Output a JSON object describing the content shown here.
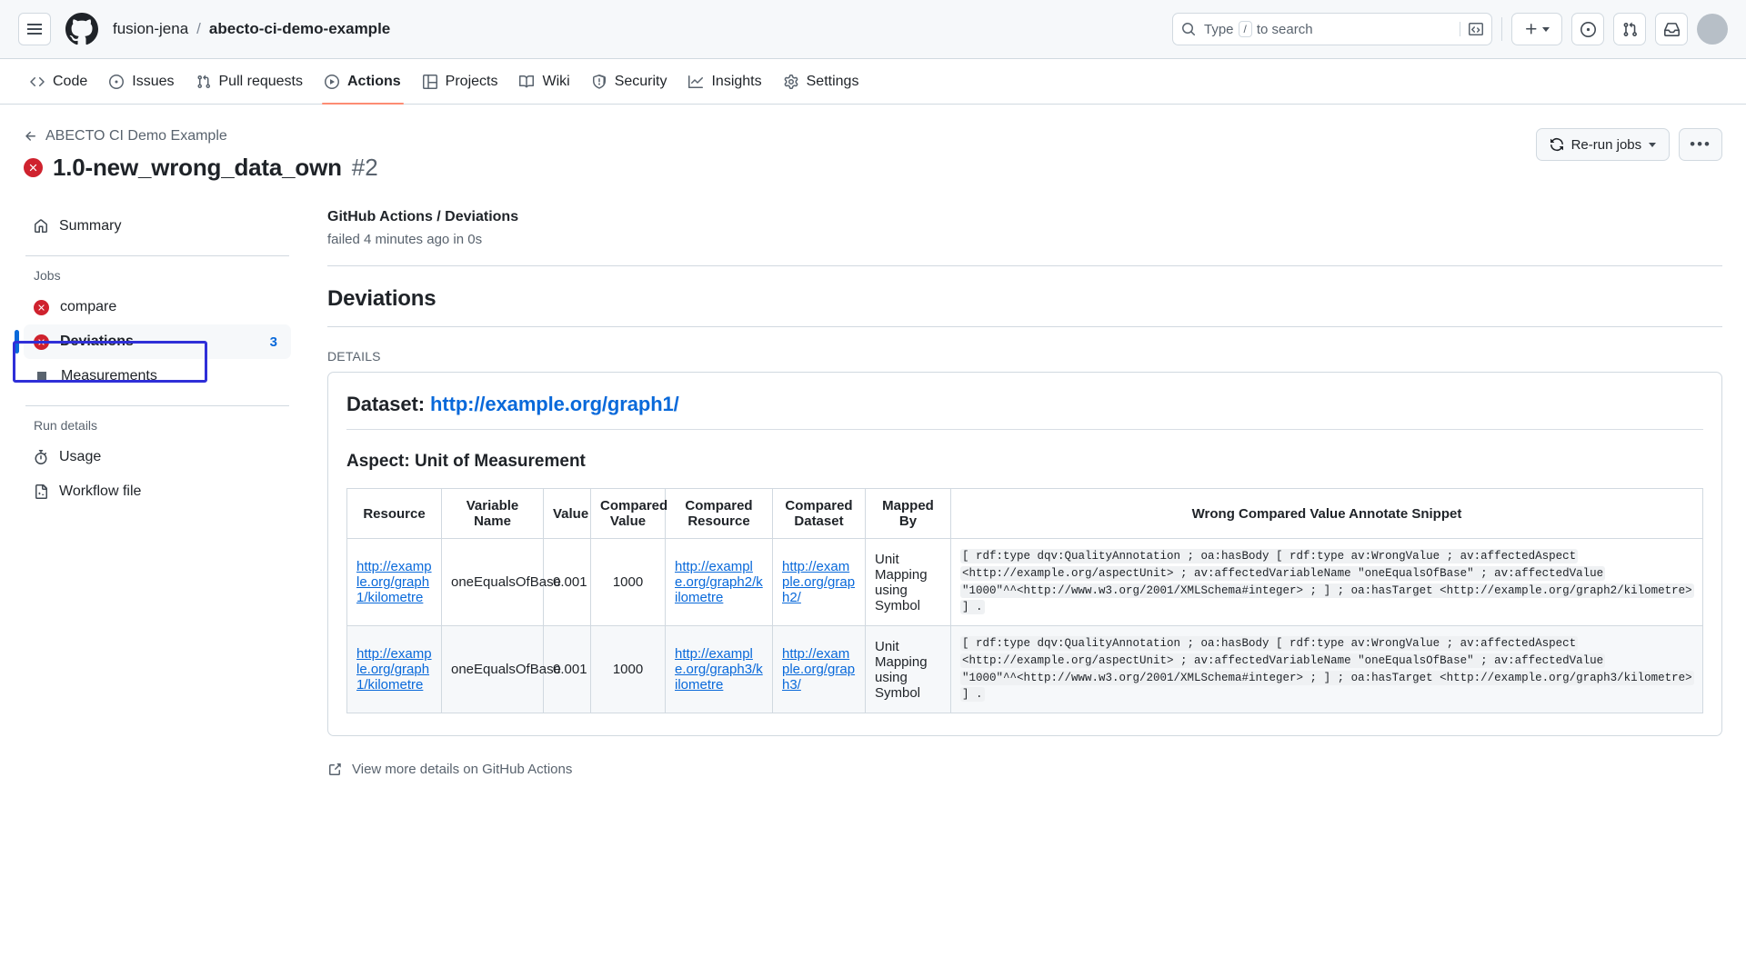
{
  "header": {
    "owner": "fusion-jena",
    "separator": "/",
    "repo": "abecto-ci-demo-example",
    "search_placeholder": "Type",
    "search_key": "/",
    "search_suffix": "to search"
  },
  "repo_nav": [
    {
      "label": "Code",
      "icon": "code-icon",
      "active": false
    },
    {
      "label": "Issues",
      "icon": "issue-opened-icon",
      "active": false
    },
    {
      "label": "Pull requests",
      "icon": "git-pull-request-icon",
      "active": false
    },
    {
      "label": "Actions",
      "icon": "play-icon",
      "active": true
    },
    {
      "label": "Projects",
      "icon": "project-icon",
      "active": false
    },
    {
      "label": "Wiki",
      "icon": "book-icon",
      "active": false
    },
    {
      "label": "Security",
      "icon": "shield-icon",
      "active": false
    },
    {
      "label": "Insights",
      "icon": "graph-icon",
      "active": false
    },
    {
      "label": "Settings",
      "icon": "gear-icon",
      "active": false
    }
  ],
  "run": {
    "back_label": "ABECTO CI Demo Example",
    "title": "1.0-new_wrong_data_own",
    "number": "#2",
    "status": "failure",
    "rerun_label": "Re-run jobs",
    "overflow_label": "•••"
  },
  "sidebar": {
    "summary_label": "Summary",
    "jobs_heading": "Jobs",
    "jobs": [
      {
        "label": "compare",
        "status": "failure",
        "count": "",
        "selected": false
      },
      {
        "label": "Deviations",
        "status": "failure",
        "count": "3",
        "selected": true
      },
      {
        "label": "Measurements",
        "status": "skipped",
        "count": "",
        "selected": false
      }
    ],
    "run_details_heading": "Run details",
    "run_details": [
      {
        "label": "Usage",
        "icon": "stopwatch-icon"
      },
      {
        "label": "Workflow file",
        "icon": "workflow-file-icon"
      }
    ]
  },
  "main": {
    "job_breadcrumb": "GitHub Actions / Deviations",
    "job_status_line": "failed 4 minutes ago in 0s",
    "section_title": "Deviations",
    "details_label": "DETAILS",
    "dataset_prefix": "Dataset:",
    "dataset_url": "http://example.org/graph1/",
    "aspect_line": "Aspect: Unit of Measurement",
    "table": {
      "headers": [
        "Resource",
        "Variable Name",
        "Value",
        "Compared Value",
        "Compared Resource",
        "Compared Dataset",
        "Mapped By",
        "Wrong Compared Value Annotate Snippet"
      ],
      "rows": [
        {
          "resource": "http://example.org/graph1/kilometre",
          "variable_name": "oneEqualsOfBase",
          "value": "0.001",
          "compared_value": "1000",
          "compared_resource": "http://example.org/graph2/kilometre",
          "compared_dataset": "http://example.org/graph2/",
          "mapped_by": "Unit Mapping using Symbol",
          "snippet": "[ rdf:type dqv:QualityAnnotation ; oa:hasBody [ rdf:type av:WrongValue ; av:affectedAspect <http://example.org/aspectUnit> ; av:affectedVariableName \"oneEqualsOfBase\" ; av:affectedValue \"1000\"^^<http://www.w3.org/2001/XMLSchema#integer> ; ] ; oa:hasTarget <http://example.org/graph2/kilometre> ] ."
        },
        {
          "resource": "http://example.org/graph1/kilometre",
          "variable_name": "oneEqualsOfBase",
          "value": "0.001",
          "compared_value": "1000",
          "compared_resource": "http://example.org/graph3/kilometre",
          "compared_dataset": "http://example.org/graph3/",
          "mapped_by": "Unit Mapping using Symbol",
          "snippet": "[ rdf:type dqv:QualityAnnotation ; oa:hasBody [ rdf:type av:WrongValue ; av:affectedAspect <http://example.org/aspectUnit> ; av:affectedVariableName \"oneEqualsOfBase\" ; av:affectedValue \"1000\"^^<http://www.w3.org/2001/XMLSchema#integer> ; ] ; oa:hasTarget <http://example.org/graph3/kilometre> ] ."
        }
      ]
    },
    "more_details_link": "View more details on GitHub Actions"
  },
  "colors": {
    "accent": "#0969da",
    "danger": "#cf222e",
    "active_tab": "#fd8c73",
    "highlight_box": "#2f2fd8"
  }
}
